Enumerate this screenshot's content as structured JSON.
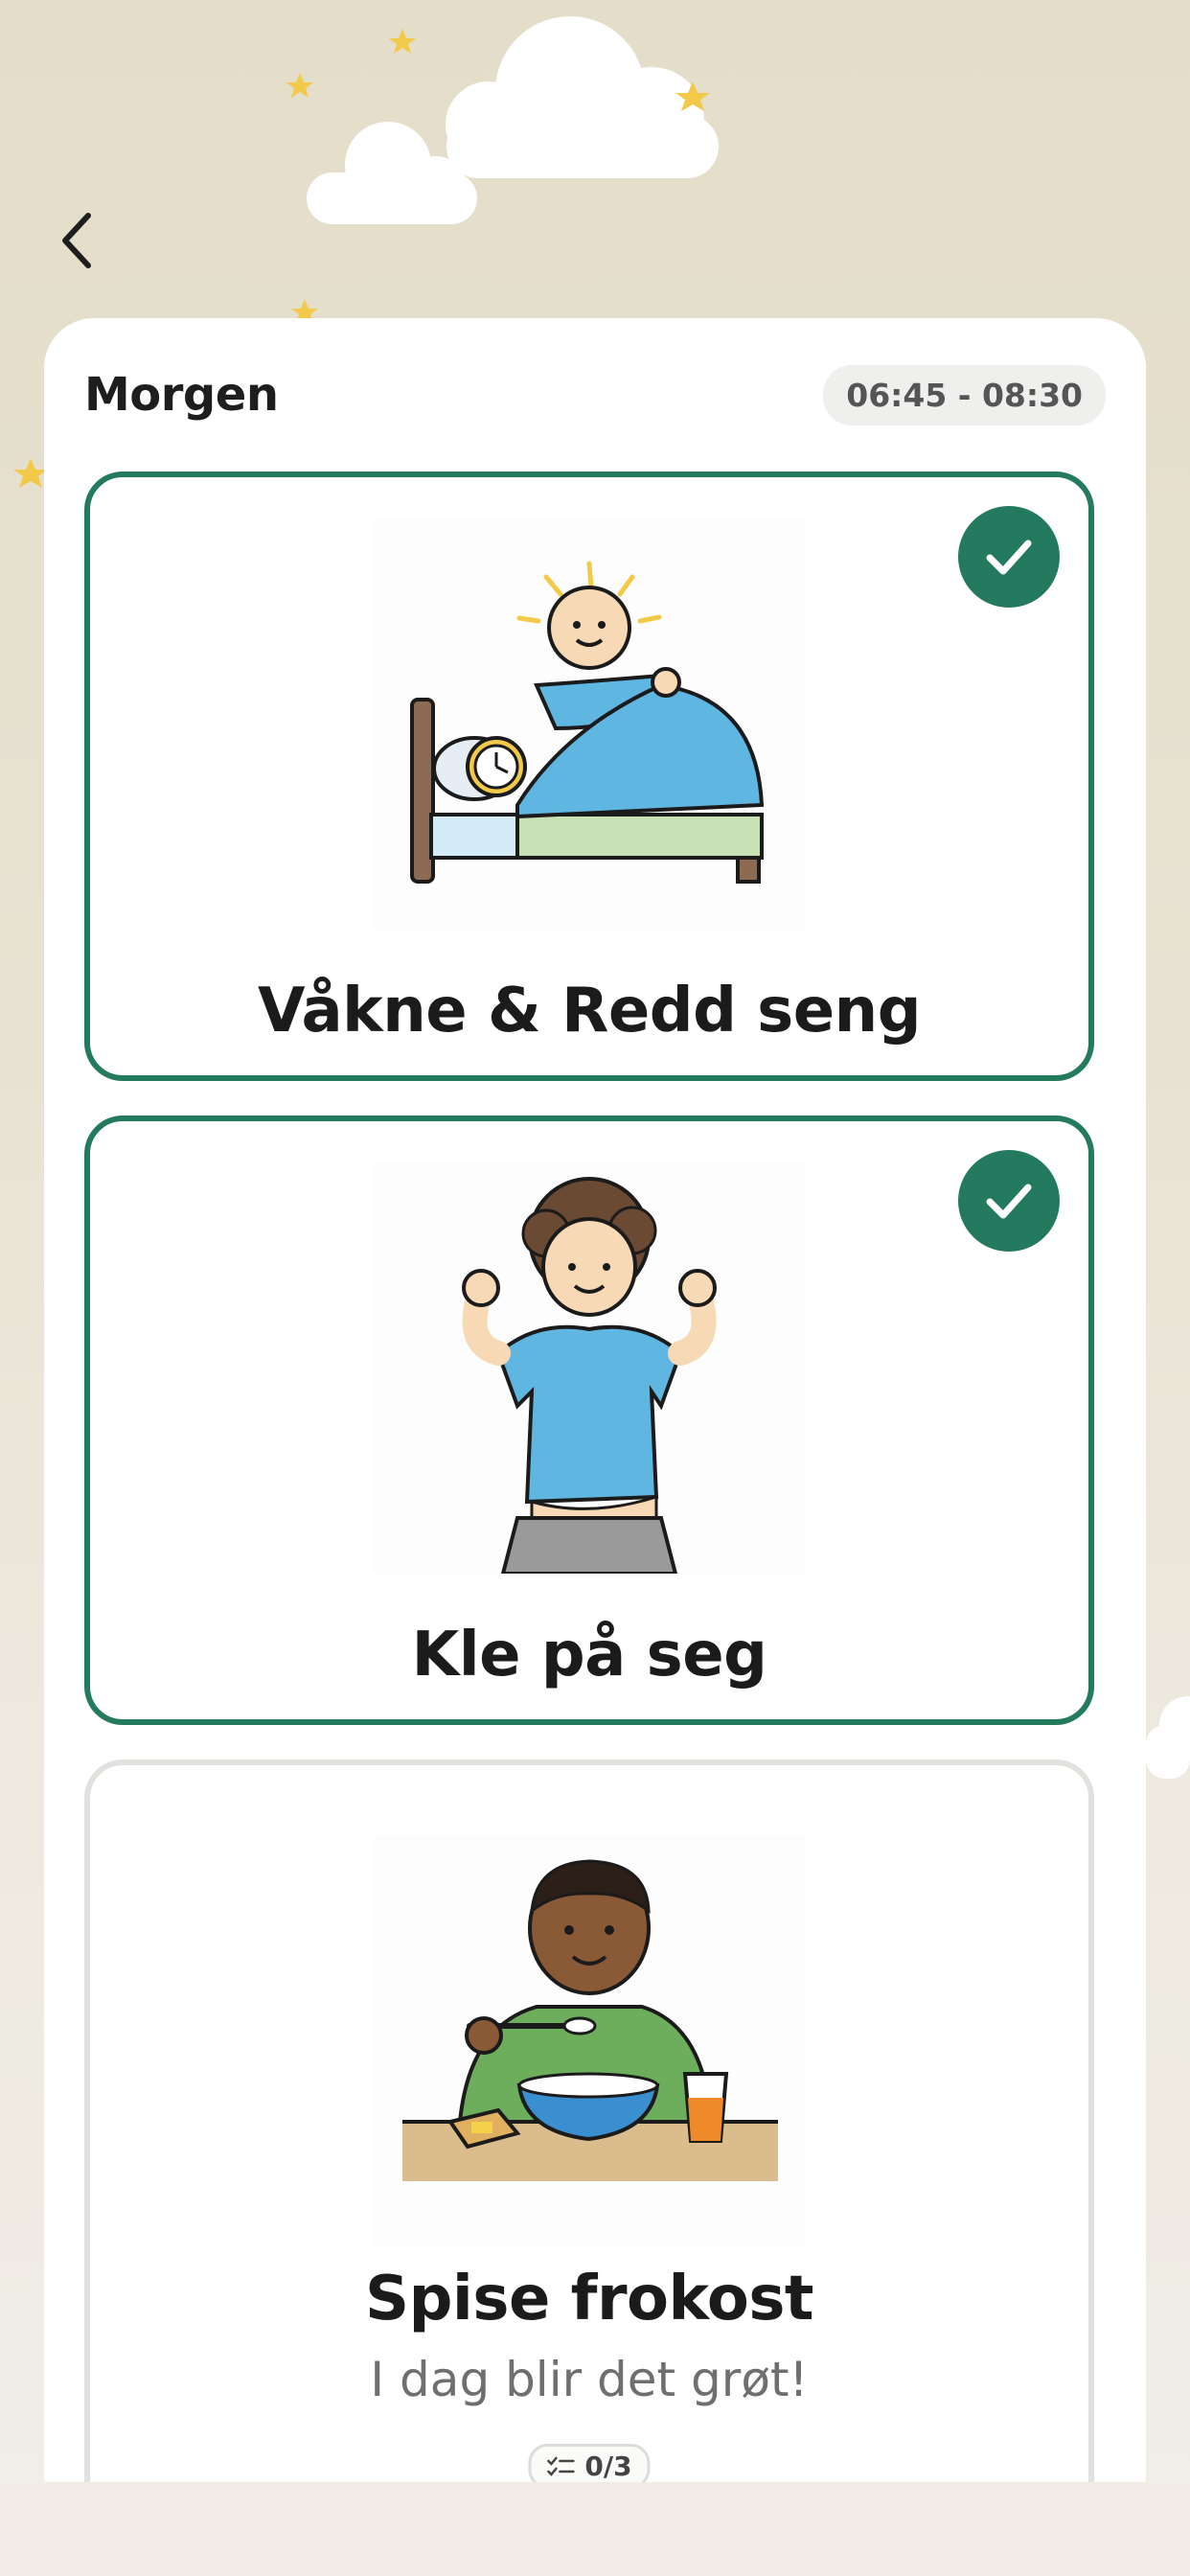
{
  "header": {
    "back_icon": "chevron-left-icon"
  },
  "section": {
    "title": "Morgen",
    "time_range": "06:45 - 08:30"
  },
  "tasks": [
    {
      "label": "Våkne & Redd seng",
      "completed": true,
      "illustration": "child-waking-up-making-bed",
      "status_icon": "checkmark-icon"
    },
    {
      "label": "Kle på seg",
      "completed": true,
      "illustration": "child-putting-on-shirt",
      "status_icon": "checkmark-icon"
    },
    {
      "label": "Spise frokost",
      "subtitle": "I dag blir det grøt!",
      "completed": false,
      "illustration": "boy-eating-breakfast",
      "checklist": "0/3",
      "checklist_icon": "checklist-icon"
    }
  ],
  "colors": {
    "accent_green": "#247a5f",
    "background_beige": "#e3ddc9",
    "star_yellow": "#f3c94a"
  }
}
